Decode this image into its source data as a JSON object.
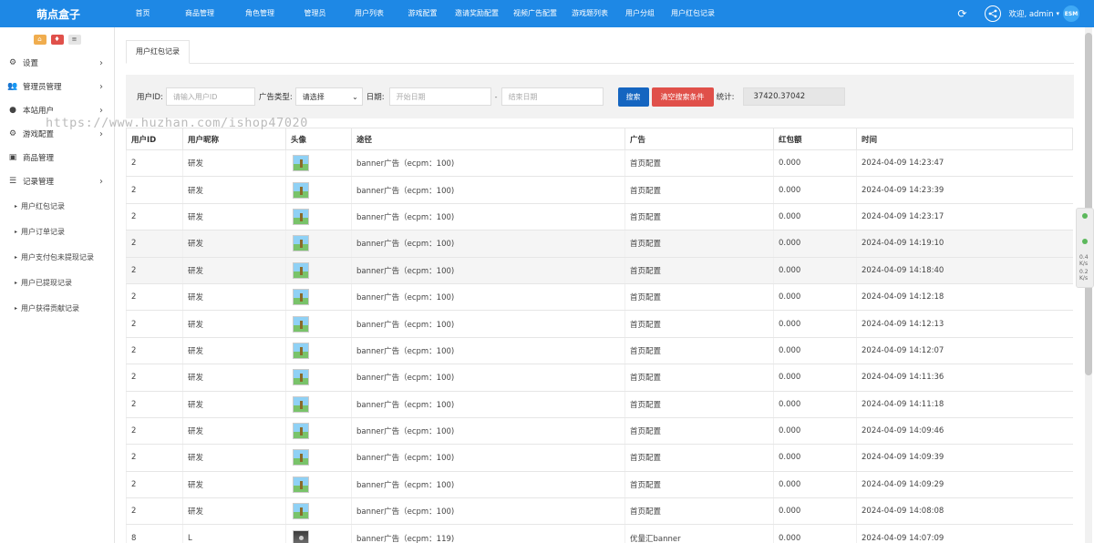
{
  "app": {
    "title": "萌点盒子"
  },
  "topnav": [
    {
      "label": "首页"
    },
    {
      "label": "商品管理"
    },
    {
      "label": "角色管理"
    },
    {
      "label": "管理员"
    },
    {
      "label": "用户列表"
    },
    {
      "label": "游戏配置"
    },
    {
      "label": "邀请奖励配置"
    },
    {
      "label": "视频广告配置"
    },
    {
      "label": "游戏题列表"
    },
    {
      "label": "用户分组"
    },
    {
      "label": "用户红包记录"
    }
  ],
  "header_right": {
    "welcome": "欢迎, admin",
    "avatar_text": "ESM",
    "refresh_icon": "refresh-icon",
    "share_icon": "share-icon"
  },
  "sidebar": {
    "items": [
      {
        "label": "设置",
        "icon": "gears-icon"
      },
      {
        "label": "管理员管理",
        "icon": "users-icon"
      },
      {
        "label": "本站用户",
        "icon": "user-icon"
      },
      {
        "label": "游戏配置",
        "icon": "gears-icon"
      },
      {
        "label": "商品管理",
        "icon": "gift-icon"
      },
      {
        "label": "记录管理",
        "icon": "list-icon"
      }
    ],
    "subitems": [
      {
        "label": "用户红包记录"
      },
      {
        "label": "用户订单记录"
      },
      {
        "label": "用户支付包未提现记录"
      },
      {
        "label": "用户已提现记录"
      },
      {
        "label": "用户获得贡献记录"
      }
    ]
  },
  "watermark": "https://www.huzhan.com/ishop47020",
  "tab": {
    "label": "用户红包记录"
  },
  "search": {
    "user_id_label": "用户ID:",
    "user_id_placeholder": "请输入用户ID",
    "ad_type_label": "广告类型:",
    "ad_type_value": "请选择",
    "date_label": "日期:",
    "start_placeholder": "开始日期",
    "dash": "-",
    "end_placeholder": "结束日期",
    "search_button": "搜索",
    "clear_button": "清空搜索条件",
    "stat_label": "统计:",
    "stat_value": "37420.37042"
  },
  "table": {
    "headers": [
      "用户ID",
      "用户昵称",
      "头像",
      "途径",
      "广告",
      "红包额",
      "时间"
    ],
    "rows": [
      {
        "uid": "2",
        "nick": "研发",
        "avatar": "thumb",
        "path": "banner广告（ecpm：100)",
        "ad": "首页配置",
        "amount": "0.000",
        "time": "2024-04-09 14:23:47"
      },
      {
        "uid": "2",
        "nick": "研发",
        "avatar": "thumb",
        "path": "banner广告（ecpm：100)",
        "ad": "首页配置",
        "amount": "0.000",
        "time": "2024-04-09 14:23:39"
      },
      {
        "uid": "2",
        "nick": "研发",
        "avatar": "thumb",
        "path": "banner广告（ecpm：100)",
        "ad": "首页配置",
        "amount": "0.000",
        "time": "2024-04-09 14:23:17"
      },
      {
        "uid": "2",
        "nick": "研发",
        "avatar": "thumb",
        "path": "banner广告（ecpm：100)",
        "ad": "首页配置",
        "amount": "0.000",
        "time": "2024-04-09 14:19:10"
      },
      {
        "uid": "2",
        "nick": "研发",
        "avatar": "thumb",
        "path": "banner广告（ecpm：100)",
        "ad": "首页配置",
        "amount": "0.000",
        "time": "2024-04-09 14:18:40"
      },
      {
        "uid": "2",
        "nick": "研发",
        "avatar": "thumb",
        "path": "banner广告（ecpm：100)",
        "ad": "首页配置",
        "amount": "0.000",
        "time": "2024-04-09 14:12:18"
      },
      {
        "uid": "2",
        "nick": "研发",
        "avatar": "thumb",
        "path": "banner广告（ecpm：100)",
        "ad": "首页配置",
        "amount": "0.000",
        "time": "2024-04-09 14:12:13"
      },
      {
        "uid": "2",
        "nick": "研发",
        "avatar": "thumb",
        "path": "banner广告（ecpm：100)",
        "ad": "首页配置",
        "amount": "0.000",
        "time": "2024-04-09 14:12:07"
      },
      {
        "uid": "2",
        "nick": "研发",
        "avatar": "thumb",
        "path": "banner广告（ecpm：100)",
        "ad": "首页配置",
        "amount": "0.000",
        "time": "2024-04-09 14:11:36"
      },
      {
        "uid": "2",
        "nick": "研发",
        "avatar": "thumb",
        "path": "banner广告（ecpm：100)",
        "ad": "首页配置",
        "amount": "0.000",
        "time": "2024-04-09 14:11:18"
      },
      {
        "uid": "2",
        "nick": "研发",
        "avatar": "thumb",
        "path": "banner广告（ecpm：100)",
        "ad": "首页配置",
        "amount": "0.000",
        "time": "2024-04-09 14:09:46"
      },
      {
        "uid": "2",
        "nick": "研发",
        "avatar": "thumb",
        "path": "banner广告（ecpm：100)",
        "ad": "首页配置",
        "amount": "0.000",
        "time": "2024-04-09 14:09:39"
      },
      {
        "uid": "2",
        "nick": "研发",
        "avatar": "thumb",
        "path": "banner广告（ecpm：100)",
        "ad": "首页配置",
        "amount": "0.000",
        "time": "2024-04-09 14:09:29"
      },
      {
        "uid": "2",
        "nick": "研发",
        "avatar": "thumb",
        "path": "banner广告（ecpm：100)",
        "ad": "首页配置",
        "amount": "0.000",
        "time": "2024-04-09 14:08:08"
      },
      {
        "uid": "8",
        "nick": "L",
        "avatar": "thumb-dark",
        "path": "banner广告（ecpm：119)",
        "ad": "优量汇banner",
        "amount": "0.000",
        "time": "2024-04-09 14:07:09"
      }
    ]
  },
  "float_widget": {
    "line1": "0.4",
    "line2": "K/s",
    "line3": "0.2",
    "line4": "K/s"
  }
}
